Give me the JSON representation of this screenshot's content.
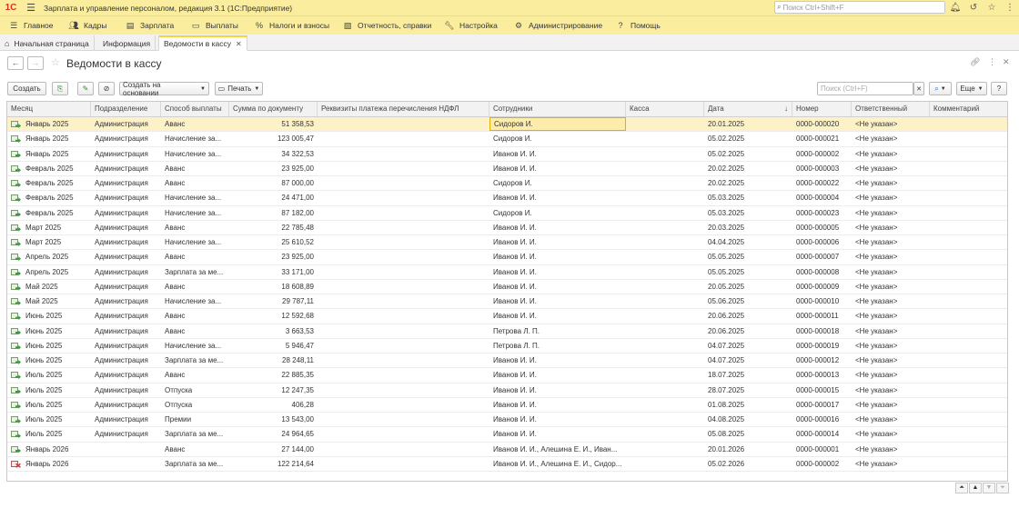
{
  "app": {
    "logo": "1С",
    "title": "Зарплата и управление персоналом, редакция 3.1  (1С:Предприятие)",
    "search_placeholder": "Поиск Ctrl+Shift+F"
  },
  "menu": [
    {
      "label": "Главное",
      "icon": "menu-icon"
    },
    {
      "label": "Кадры",
      "icon": "people-icon"
    },
    {
      "label": "Зарплата",
      "icon": "list-icon"
    },
    {
      "label": "Выплаты",
      "icon": "cash-icon"
    },
    {
      "label": "Налоги и взносы",
      "icon": "percent-icon"
    },
    {
      "label": "Отчетность, справки",
      "icon": "report-icon"
    },
    {
      "label": "Настройка",
      "icon": "wrench-icon"
    },
    {
      "label": "Администрирование",
      "icon": "gear-icon"
    },
    {
      "label": "Помощь",
      "icon": "help-icon"
    }
  ],
  "tabs": [
    {
      "label": "Начальная страница",
      "active": false
    },
    {
      "label": "Информация",
      "active": false
    },
    {
      "label": "Ведомости в кассу",
      "active": true
    }
  ],
  "form": {
    "title": "Ведомости в кассу"
  },
  "toolbar": {
    "create": "Создать",
    "create_based": "Создать на основании",
    "print": "Печать",
    "search_placeholder": "Поиск (Ctrl+F)",
    "more": "Еще",
    "help": "?"
  },
  "columns": [
    "Месяц",
    "Подразделение",
    "Способ выплаты",
    "Сумма по документу",
    "Реквизиты платежа перечисления НДФЛ",
    "Сотрудники",
    "Касса",
    "Дата",
    "Номер",
    "Ответственный",
    "Комментарий"
  ],
  "rows": [
    [
      "Январь 2025",
      "Администрация",
      "Аванс",
      "51 358,53",
      "",
      "Сидоров И.",
      "",
      "20.01.2025",
      "0000-000020",
      "<Не указан>",
      ""
    ],
    [
      "Январь 2025",
      "Администрация",
      "Начисление за...",
      "123 005,47",
      "",
      "Сидоров И.",
      "",
      "05.02.2025",
      "0000-000021",
      "<Не указан>",
      ""
    ],
    [
      "Январь 2025",
      "Администрация",
      "Начисление за...",
      "34 322,53",
      "",
      "Иванов И. И.",
      "",
      "05.02.2025",
      "0000-000002",
      "<Не указан>",
      ""
    ],
    [
      "Февраль 2025",
      "Администрация",
      "Аванс",
      "23 925,00",
      "",
      "Иванов И. И.",
      "",
      "20.02.2025",
      "0000-000003",
      "<Не указан>",
      ""
    ],
    [
      "Февраль 2025",
      "Администрация",
      "Аванс",
      "87 000,00",
      "",
      "Сидоров И.",
      "",
      "20.02.2025",
      "0000-000022",
      "<Не указан>",
      ""
    ],
    [
      "Февраль 2025",
      "Администрация",
      "Начисление за...",
      "24 471,00",
      "",
      "Иванов И. И.",
      "",
      "05.03.2025",
      "0000-000004",
      "<Не указан>",
      ""
    ],
    [
      "Февраль 2025",
      "Администрация",
      "Начисление за...",
      "87 182,00",
      "",
      "Сидоров И.",
      "",
      "05.03.2025",
      "0000-000023",
      "<Не указан>",
      ""
    ],
    [
      "Март 2025",
      "Администрация",
      "Аванс",
      "22 785,48",
      "",
      "Иванов И. И.",
      "",
      "20.03.2025",
      "0000-000005",
      "<Не указан>",
      ""
    ],
    [
      "Март 2025",
      "Администрация",
      "Начисление за...",
      "25 610,52",
      "",
      "Иванов И. И.",
      "",
      "04.04.2025",
      "0000-000006",
      "<Не указан>",
      ""
    ],
    [
      "Апрель 2025",
      "Администрация",
      "Аванс",
      "23 925,00",
      "",
      "Иванов И. И.",
      "",
      "05.05.2025",
      "0000-000007",
      "<Не указан>",
      ""
    ],
    [
      "Апрель 2025",
      "Администрация",
      "Зарплата за ме...",
      "33 171,00",
      "",
      "Иванов И. И.",
      "",
      "05.05.2025",
      "0000-000008",
      "<Не указан>",
      ""
    ],
    [
      "Май 2025",
      "Администрация",
      "Аванс",
      "18 608,89",
      "",
      "Иванов И. И.",
      "",
      "20.05.2025",
      "0000-000009",
      "<Не указан>",
      ""
    ],
    [
      "Май 2025",
      "Администрация",
      "Начисление за...",
      "29 787,11",
      "",
      "Иванов И. И.",
      "",
      "05.06.2025",
      "0000-000010",
      "<Не указан>",
      ""
    ],
    [
      "Июнь 2025",
      "Администрация",
      "Аванс",
      "12 592,68",
      "",
      "Иванов И. И.",
      "",
      "20.06.2025",
      "0000-000011",
      "<Не указан>",
      ""
    ],
    [
      "Июнь 2025",
      "Администрация",
      "Аванс",
      "3 663,53",
      "",
      "Петрова Л. П.",
      "",
      "20.06.2025",
      "0000-000018",
      "<Не указан>",
      ""
    ],
    [
      "Июнь 2025",
      "Администрация",
      "Начисление за...",
      "5 946,47",
      "",
      "Петрова Л. П.",
      "",
      "04.07.2025",
      "0000-000019",
      "<Не указан>",
      ""
    ],
    [
      "Июнь 2025",
      "Администрация",
      "Зарплата за ме...",
      "28 248,11",
      "",
      "Иванов И. И.",
      "",
      "04.07.2025",
      "0000-000012",
      "<Не указан>",
      ""
    ],
    [
      "Июль 2025",
      "Администрация",
      "Аванс",
      "22 885,35",
      "",
      "Иванов И. И.",
      "",
      "18.07.2025",
      "0000-000013",
      "<Не указан>",
      ""
    ],
    [
      "Июль 2025",
      "Администрация",
      "Отпуска",
      "12 247,35",
      "",
      "Иванов И. И.",
      "",
      "28.07.2025",
      "0000-000015",
      "<Не указан>",
      ""
    ],
    [
      "Июль 2025",
      "Администрация",
      "Отпуска",
      "406,28",
      "",
      "Иванов И. И.",
      "",
      "01.08.2025",
      "0000-000017",
      "<Не указан>",
      ""
    ],
    [
      "Июль 2025",
      "Администрация",
      "Премии",
      "13 543,00",
      "",
      "Иванов И. И.",
      "",
      "04.08.2025",
      "0000-000016",
      "<Не указан>",
      ""
    ],
    [
      "Июль 2025",
      "Администрация",
      "Зарплата за ме...",
      "24 964,65",
      "",
      "Иванов И. И.",
      "",
      "05.08.2025",
      "0000-000014",
      "<Не указан>",
      ""
    ],
    [
      "Январь 2026",
      "",
      "Аванс",
      "27 144,00",
      "",
      "Иванов И. И., Алешина Е. И., Иван...",
      "",
      "20.01.2026",
      "0000-000001",
      "<Не указан>",
      ""
    ],
    [
      "Январь 2026",
      "",
      "Зарплата за ме...",
      "122 214,64",
      "",
      "Иванов И. И., Алешина Е. И., Сидор...",
      "",
      "05.02.2026",
      "0000-000002",
      "<Не указан>",
      ""
    ]
  ],
  "row_status": [
    "posted",
    "posted",
    "posted",
    "posted",
    "posted",
    "posted",
    "posted",
    "posted",
    "posted",
    "posted",
    "posted",
    "posted",
    "posted",
    "posted",
    "posted",
    "posted",
    "posted",
    "posted",
    "posted",
    "posted",
    "posted",
    "posted",
    "posted",
    "deleted"
  ],
  "sort_indicator": "↓",
  "colors": {
    "accent": "#fbed9e",
    "selected_row": "#fdf1c7",
    "active_cell": "#fdecaa"
  }
}
